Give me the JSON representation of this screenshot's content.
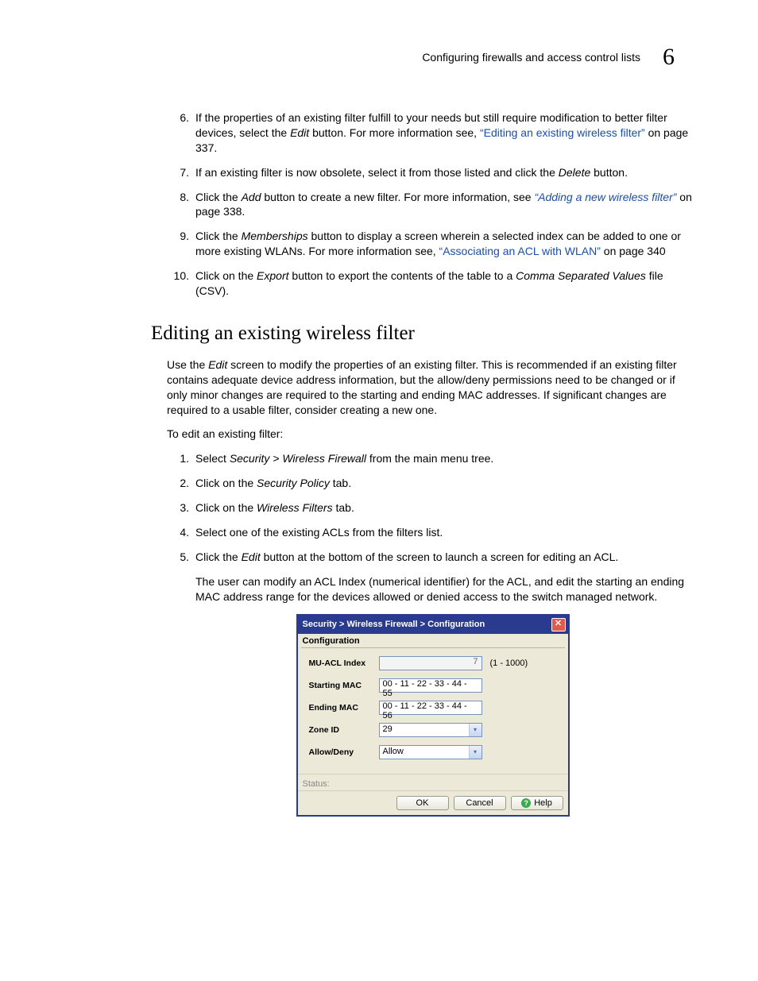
{
  "header": {
    "title": "Configuring firewalls and access control lists",
    "chapter": "6"
  },
  "list1": {
    "i6": {
      "n": "6.",
      "t1": "If the properties of an existing filter fulfill to your needs but still require modification to better filter devices, select the ",
      "em1": "Edit",
      "t2": " button. For more information see, ",
      "link": "“Editing an existing wireless filter”",
      "t3": " on page 337."
    },
    "i7": {
      "n": "7.",
      "t1": "If an existing filter is now obsolete, select it from those listed and click the ",
      "em1": "Delete",
      "t2": " button."
    },
    "i8": {
      "n": "8.",
      "t1": "Click the ",
      "em1": "Add",
      "t2": " button to create a new filter. For more information, see ",
      "link": "“Adding a new wireless filter”",
      "t3": " on page 338."
    },
    "i9": {
      "n": "9.",
      "t1": "Click the ",
      "em1": "Memberships",
      "t2": " button to display a screen wherein a selected index can be added to one or more existing WLANs. For more information see, ",
      "link": "“Associating an ACL with WLAN”",
      "t3": " on page 340"
    },
    "i10": {
      "n": "10.",
      "t1": "Click on the ",
      "em1": "Export",
      "t2": " button to export the contents of the table to a ",
      "em2": "Comma Separated Values",
      "t3": " file (CSV)."
    }
  },
  "section_heading": "Editing an existing wireless filter",
  "para1": {
    "t1": "Use the ",
    "em1": "Edit",
    "t2": " screen to modify the properties of an existing filter. This is recommended if an existing filter contains adequate device address information, but the allow/deny permissions need to be changed or if only minor changes are required to the starting and ending MAC addresses. If significant changes are required to a usable filter, consider creating a new one."
  },
  "para2": "To edit an existing filter:",
  "list2": {
    "i1": {
      "n": "1.",
      "t1": "Select ",
      "em1": "Security > Wireless Firewall",
      "t2": " from the main menu tree."
    },
    "i2": {
      "n": "2.",
      "t1": "Click on the ",
      "em1": "Security Policy",
      "t2": " tab."
    },
    "i3": {
      "n": "3.",
      "t1": "Click on the ",
      "em1": "Wireless Filters",
      "t2": " tab."
    },
    "i4": {
      "n": "4.",
      "t1": "Select one of the existing ACLs from the filters list."
    },
    "i5": {
      "n": "5.",
      "t1": "Click the ",
      "em1": "Edit",
      "t2": " button at the bottom of the screen to launch a screen for editing an ACL."
    }
  },
  "note5": "The user can modify an ACL Index (numerical identifier) for the ACL, and edit the starting an ending MAC address range for the devices allowed or denied access to the switch managed network.",
  "dialog": {
    "title": "Security > Wireless Firewall > Configuration",
    "section": "Configuration",
    "labels": {
      "muacl": "MU-ACL Index",
      "start": "Starting MAC",
      "end": "Ending MAC",
      "zone": "Zone ID",
      "allow": "Allow/Deny"
    },
    "values": {
      "muacl": "7",
      "range": "(1 - 1000)",
      "start": "00 - 11 - 22 - 33 - 44 - 55",
      "end": "00 - 11 - 22 - 33 - 44 - 56",
      "zone": "29",
      "allow": "Allow"
    },
    "status": "Status:",
    "buttons": {
      "ok": "OK",
      "cancel": "Cancel",
      "help": "Help"
    }
  }
}
